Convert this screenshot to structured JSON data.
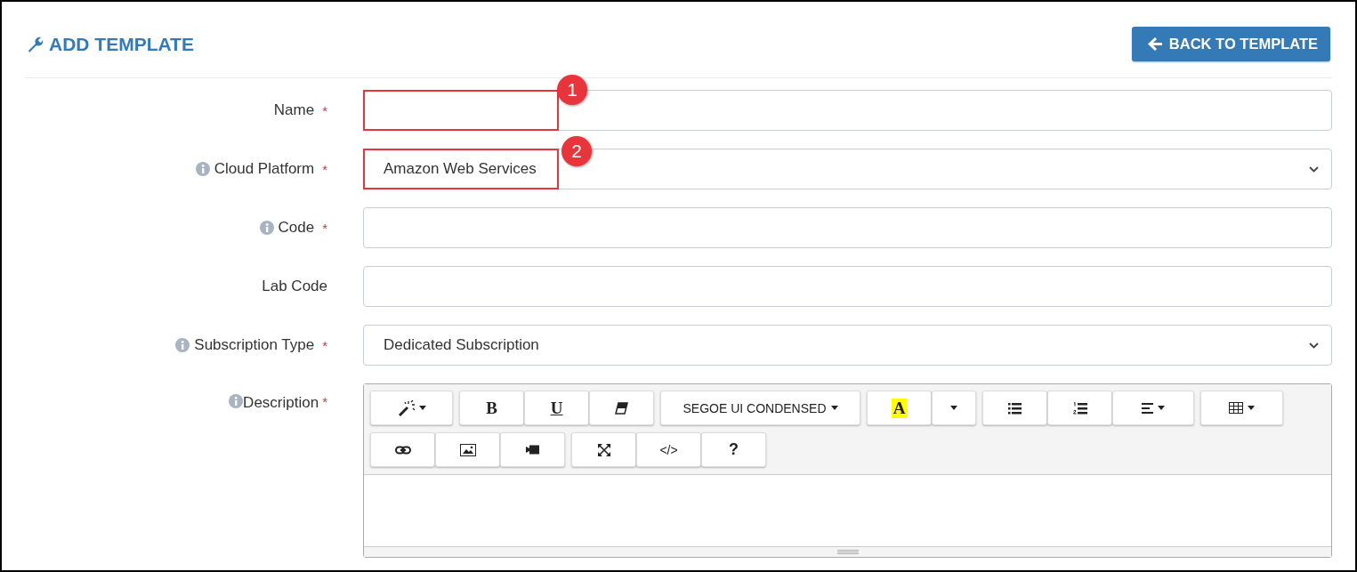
{
  "header": {
    "title": "ADD TEMPLATE",
    "back_button": "BACK TO TEMPLATE"
  },
  "fields": [
    {
      "label": "Name",
      "required_mark": "*",
      "info": false,
      "kind": "text",
      "annotation": "1"
    },
    {
      "label": "Cloud Platform",
      "required_mark": "*",
      "info": true,
      "kind": "select",
      "value": "Amazon Web Services",
      "annotation": "2"
    },
    {
      "label": "Code",
      "required_mark": "*",
      "info": true,
      "kind": "text"
    },
    {
      "label": "Lab Code",
      "info": false,
      "kind": "text"
    },
    {
      "label": "Subscription Type",
      "required_mark": "*",
      "info": true,
      "kind": "select",
      "value": "Dedicated Subscription"
    },
    {
      "label": "Description",
      "required_mark": "*",
      "info": true,
      "kind": "editor"
    }
  ],
  "editor_toolbar": [
    [
      [
        {
          "kind": "magic",
          "caret": true
        }
      ],
      [
        {
          "kind": "bold",
          "text": "B"
        },
        {
          "kind": "underline",
          "text": "U"
        },
        {
          "kind": "eraser"
        }
      ],
      [
        {
          "kind": "font",
          "text": "SEGOE UI CONDENSED",
          "caret": true
        }
      ],
      [
        {
          "kind": "color",
          "text": "A"
        },
        {
          "kind": "dropdown",
          "caret": true
        }
      ],
      [
        {
          "kind": "bullets"
        },
        {
          "kind": "numbers"
        },
        {
          "kind": "align",
          "caret": true
        }
      ],
      [
        {
          "kind": "table",
          "caret": true
        }
      ]
    ],
    [
      [
        {
          "kind": "link"
        },
        {
          "kind": "picture"
        },
        {
          "kind": "video"
        }
      ],
      [
        {
          "kind": "fullscreen"
        },
        {
          "kind": "code",
          "text": "</>"
        },
        {
          "kind": "help",
          "text": "?"
        }
      ]
    ]
  ]
}
